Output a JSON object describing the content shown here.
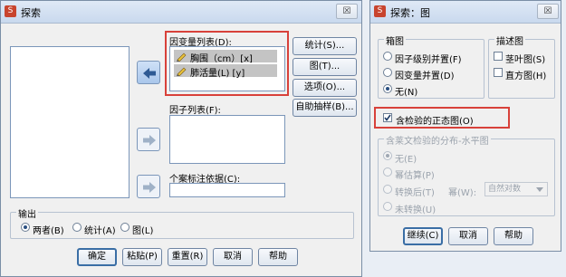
{
  "main_dialog": {
    "title": "探索",
    "close": "☒",
    "dependent_list_label": "因变量列表(D):",
    "dependent_items": [
      "胸围（cm）[x]",
      "肺活量(L) [y]"
    ],
    "factor_list_label": "因子列表(F):",
    "case_label_label": "个案标注依据(C):",
    "side_buttons": [
      "统计(S)...",
      "图(T)...",
      "选项(O)...",
      "自助抽样(B)..."
    ],
    "output_group_title": "输出",
    "output_options": [
      "两者(B)",
      "统计(A)",
      "图(L)"
    ],
    "output_selected": "两者(B)",
    "bottom_buttons": [
      "确定",
      "粘贴(P)",
      "重置(R)",
      "取消",
      "帮助"
    ]
  },
  "plot_dialog": {
    "title": "探索：图",
    "close": "☒",
    "boxplot_group_title": "箱图",
    "boxplot_options": [
      "因子级别并置(F)",
      "因变量并置(D)",
      "无(N)"
    ],
    "boxplot_selected": "无(N)",
    "descriptive_group_title": "描述图",
    "descriptive_options": [
      "茎叶图(S)",
      "直方图(H)"
    ],
    "normality_label": "含检验的正态图(O)",
    "normality_checked": true,
    "levene_group_title": "含莱文检验的分布-水平图",
    "levene_options": [
      "无(E)",
      "幂估算(P)",
      "转换后(T)",
      "未转换(U)"
    ],
    "power_label": "幂(W):",
    "power_value": "自然对数",
    "bottom_buttons": [
      "继续(C)",
      "取消",
      "帮助"
    ]
  },
  "colors": {
    "highlight": "#d8413a",
    "accent": "#3a6ea5"
  }
}
